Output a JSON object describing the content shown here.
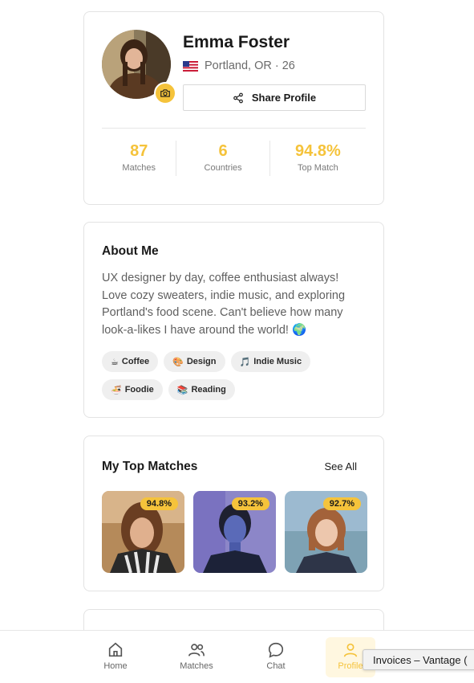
{
  "profile": {
    "name": "Emma Foster",
    "location": "Portland, OR · 26",
    "share_label": "Share Profile",
    "stats": [
      {
        "value": "87",
        "label": "Matches"
      },
      {
        "value": "6",
        "label": "Countries"
      },
      {
        "value": "94.8%",
        "label": "Top Match"
      }
    ]
  },
  "about": {
    "title": "About Me",
    "text": "UX designer by day, coffee enthusiast always! Love cozy sweaters, indie music, and exploring Portland's food scene. Can't believe how many look-a-likes I have around the world! 🌍",
    "tags": [
      {
        "icon": "☕",
        "label": "Coffee"
      },
      {
        "icon": "🎨",
        "label": "Design"
      },
      {
        "icon": "🎵",
        "label": "Indie Music"
      },
      {
        "icon": "🍜",
        "label": "Foodie"
      },
      {
        "icon": "📚",
        "label": "Reading"
      }
    ]
  },
  "top_matches": {
    "title": "My Top Matches",
    "see_all": "See All",
    "items": [
      {
        "percent": "94.8%"
      },
      {
        "percent": "93.2%"
      },
      {
        "percent": "92.7%"
      }
    ]
  },
  "nav": {
    "items": [
      {
        "label": "Home",
        "icon": "home-icon"
      },
      {
        "label": "Matches",
        "icon": "users-icon"
      },
      {
        "label": "Chat",
        "icon": "chat-icon"
      },
      {
        "label": "Profile",
        "icon": "user-icon",
        "active": true
      }
    ]
  },
  "tooltip": "Invoices – Vantage ("
}
